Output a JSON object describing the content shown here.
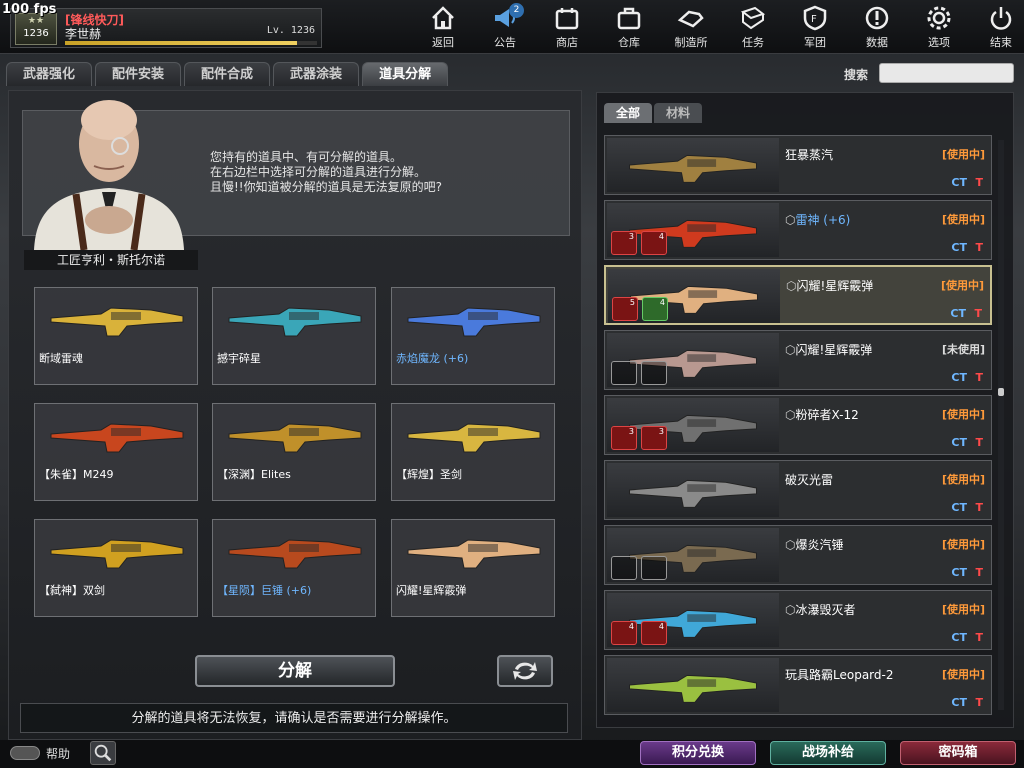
{
  "fps": "100 fps",
  "player": {
    "rank": "1236",
    "title": "[锋线快刀]",
    "name": "李世赫",
    "level": "Lv. 1236",
    "xp_fraction": 0.92
  },
  "nav": [
    {
      "id": "home",
      "label": "返回"
    },
    {
      "id": "notice",
      "label": "公告",
      "badge": "2"
    },
    {
      "id": "shop",
      "label": "商店"
    },
    {
      "id": "storage",
      "label": "仓库"
    },
    {
      "id": "craft",
      "label": "制造所"
    },
    {
      "id": "mission",
      "label": "任务"
    },
    {
      "id": "clan",
      "label": "军团"
    },
    {
      "id": "data",
      "label": "数据"
    },
    {
      "id": "options",
      "label": "选项"
    },
    {
      "id": "exit",
      "label": "结束"
    }
  ],
  "tabs": [
    "武器强化",
    "配件安装",
    "配件合成",
    "武器涂装",
    "道具分解"
  ],
  "active_tab": 4,
  "search": {
    "label": "搜索",
    "value": ""
  },
  "npc": {
    "name": "工匠亨利・斯托尔诺",
    "lines": [
      "您持有的道具中、有可分解的道具。",
      "在右边栏中选择可分解的道具进行分解。",
      "且慢!!你知道被分解的道具是无法复原的吧?"
    ]
  },
  "grid": [
    {
      "label": "断域雷魂",
      "blue": false,
      "color": "#d9b23a"
    },
    {
      "label": "撼宇碎星",
      "blue": false,
      "color": "#3aa6b8"
    },
    {
      "label": "赤焰魔龙 (+6)",
      "blue": true,
      "color": "#4a7adc"
    },
    {
      "label": "【朱雀】M249",
      "blue": false,
      "color": "#c8461e"
    },
    {
      "label": "【深渊】Elites",
      "blue": false,
      "color": "#c0902a"
    },
    {
      "label": "【辉煌】圣剑",
      "blue": false,
      "color": "#d8b640"
    },
    {
      "label": "【弑神】双剑",
      "blue": false,
      "color": "#d0a020"
    },
    {
      "label": "【星陨】巨锤 (+6)",
      "blue": true,
      "color": "#b84a1e"
    },
    {
      "label": "闪耀!星辉霰弹",
      "blue": false,
      "color": "#e0b080"
    }
  ],
  "decompose_label": "分解",
  "warning": "分解的道具将无法恢复，请确认是否需要进行分解操作。",
  "right_tabs": [
    "全部",
    "材料"
  ],
  "inventory": [
    {
      "name": "狂暴蒸汽",
      "status": "[使用中]",
      "blue": false,
      "mark": false,
      "slots": [],
      "color": "#a08040"
    },
    {
      "name": "雷神 (+6)",
      "status": "[使用中]",
      "blue": true,
      "mark": true,
      "slots": [
        {
          "c": "red",
          "n": "3"
        },
        {
          "c": "red",
          "n": "4"
        }
      ],
      "color": "#d03a1e"
    },
    {
      "name": "闪耀!星辉霰弹",
      "status": "[使用中]",
      "blue": false,
      "mark": true,
      "selected": true,
      "slots": [
        {
          "c": "red",
          "n": "5"
        },
        {
          "c": "green",
          "n": "4"
        }
      ],
      "color": "#e0b080"
    },
    {
      "name": "闪耀!星辉霰弹",
      "status": "[未使用]",
      "blue": false,
      "mark": true,
      "slots": [
        {
          "c": "empty",
          "n": ""
        },
        {
          "c": "empty",
          "n": ""
        }
      ],
      "color": "#b89890"
    },
    {
      "name": "粉碎者X-12",
      "status": "[使用中]",
      "blue": false,
      "mark": true,
      "slots": [
        {
          "c": "red",
          "n": "3"
        },
        {
          "c": "red",
          "n": "3"
        }
      ],
      "color": "#707070"
    },
    {
      "name": "破灭光雷",
      "status": "[使用中]",
      "blue": false,
      "mark": false,
      "slots": [],
      "color": "#8a8a8a"
    },
    {
      "name": "爆炎汽锤",
      "status": "[使用中]",
      "blue": false,
      "mark": true,
      "slots": [
        {
          "c": "empty",
          "n": ""
        },
        {
          "c": "empty",
          "n": ""
        }
      ],
      "color": "#7a6a50"
    },
    {
      "name": "冰瀑毁灭者",
      "status": "[使用中]",
      "blue": false,
      "mark": true,
      "slots": [
        {
          "c": "red",
          "n": "4"
        },
        {
          "c": "red",
          "n": "4"
        }
      ],
      "color": "#40a8d8"
    },
    {
      "name": "玩具路霸Leopard-2",
      "status": "[使用中]",
      "blue": false,
      "mark": false,
      "slots": [],
      "color": "#9ac040"
    }
  ],
  "team": {
    "ct": "CT",
    "t": "T"
  },
  "bottom": {
    "help": "帮助",
    "exchange": "积分兑换",
    "supply": "战场补给",
    "chest": "密码箱"
  },
  "colors": {
    "in_use": "#ff9a3a",
    "ct": "#6fb7ff",
    "t": "#ff4a4a",
    "selected_border": "#c8c090"
  }
}
